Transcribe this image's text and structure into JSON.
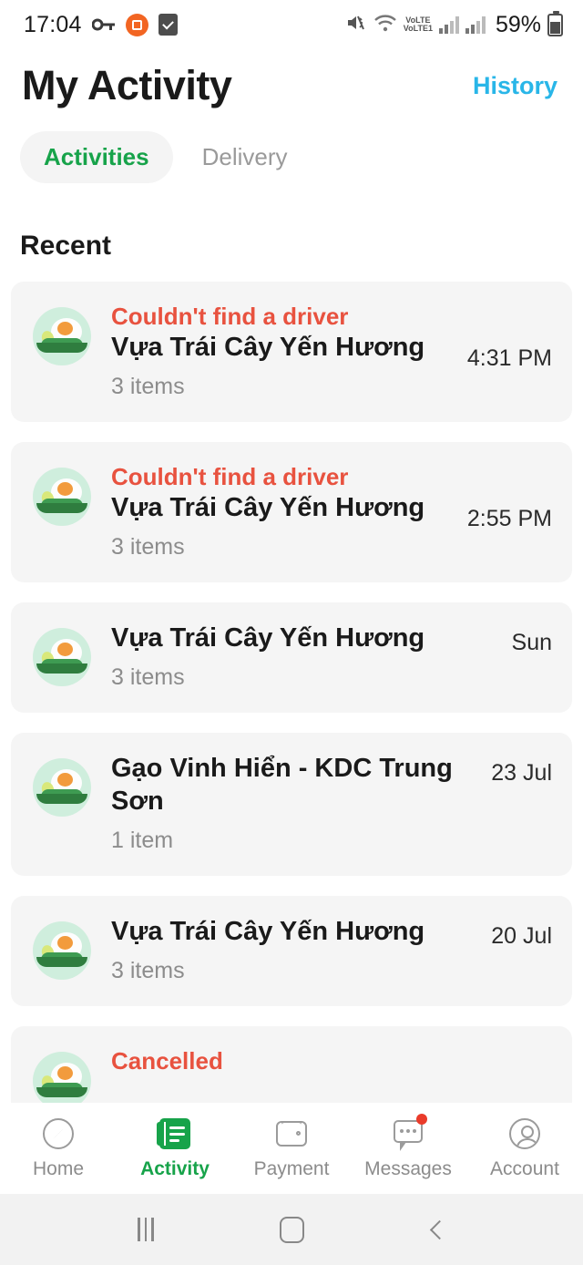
{
  "status_bar": {
    "time": "17:04",
    "battery_percent": "59%",
    "network_label": "VoLTE1",
    "icons": [
      "key-icon",
      "orange-app-icon",
      "checkbox-icon",
      "mute-icon",
      "wifi-icon",
      "volte-icon",
      "signal-icon-1",
      "signal-icon-2",
      "battery-icon"
    ]
  },
  "header": {
    "title": "My Activity",
    "history_label": "History"
  },
  "tabs": [
    {
      "label": "Activities",
      "active": true
    },
    {
      "label": "Delivery",
      "active": false
    }
  ],
  "section": {
    "title": "Recent"
  },
  "orders": [
    {
      "status": "Couldn't find a driver",
      "name": "Vựa Trái Cây Yến Hương",
      "items": "3 items",
      "time": "4:31 PM"
    },
    {
      "status": "Couldn't find a driver",
      "name": "Vựa Trái Cây Yến Hương",
      "items": "3 items",
      "time": "2:55 PM"
    },
    {
      "status": "",
      "name": "Vựa Trái Cây Yến Hương",
      "items": "3 items",
      "time": "Sun"
    },
    {
      "status": "",
      "name": "Gạo Vinh Hiển - KDC Trung Sơn",
      "items": "1 item",
      "time": "23 Jul"
    },
    {
      "status": "",
      "name": "Vựa Trái Cây Yến Hương",
      "items": "3 items",
      "time": "20 Jul"
    },
    {
      "status": "Cancelled",
      "name": "",
      "items": "",
      "time": ""
    }
  ],
  "bottom_nav": [
    {
      "label": "Home",
      "icon": "compass-icon",
      "active": false
    },
    {
      "label": "Activity",
      "icon": "document-icon",
      "active": true
    },
    {
      "label": "Payment",
      "icon": "wallet-icon",
      "active": false
    },
    {
      "label": "Messages",
      "icon": "chat-icon",
      "active": false,
      "badge": true
    },
    {
      "label": "Account",
      "icon": "person-icon",
      "active": false
    }
  ],
  "system_nav": [
    "recents-button",
    "home-button",
    "back-button"
  ],
  "colors": {
    "accent_green": "#17a34a",
    "link_blue": "#29b6e8",
    "alert_red": "#e8523f",
    "card_bg": "#f5f5f5",
    "muted_text": "#8c8c8c"
  }
}
